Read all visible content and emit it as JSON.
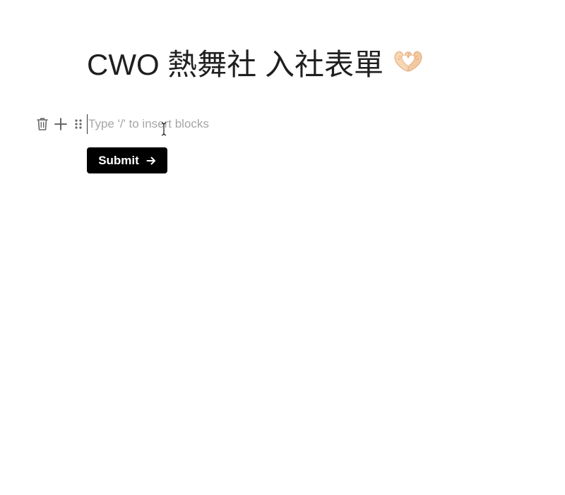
{
  "form": {
    "title": "CWO 熱舞社 入社表單",
    "title_emoji": "heart-hands-emoji"
  },
  "block_editor": {
    "placeholder": "Type '/' to insert blocks",
    "value": "",
    "tools": {
      "delete_icon": "trash-icon",
      "add_icon": "plus-icon",
      "drag_icon": "drag-handle-icon"
    }
  },
  "submit": {
    "label": "Submit",
    "icon": "arrow-right-icon",
    "background": "#000000",
    "text_color": "#ffffff"
  }
}
